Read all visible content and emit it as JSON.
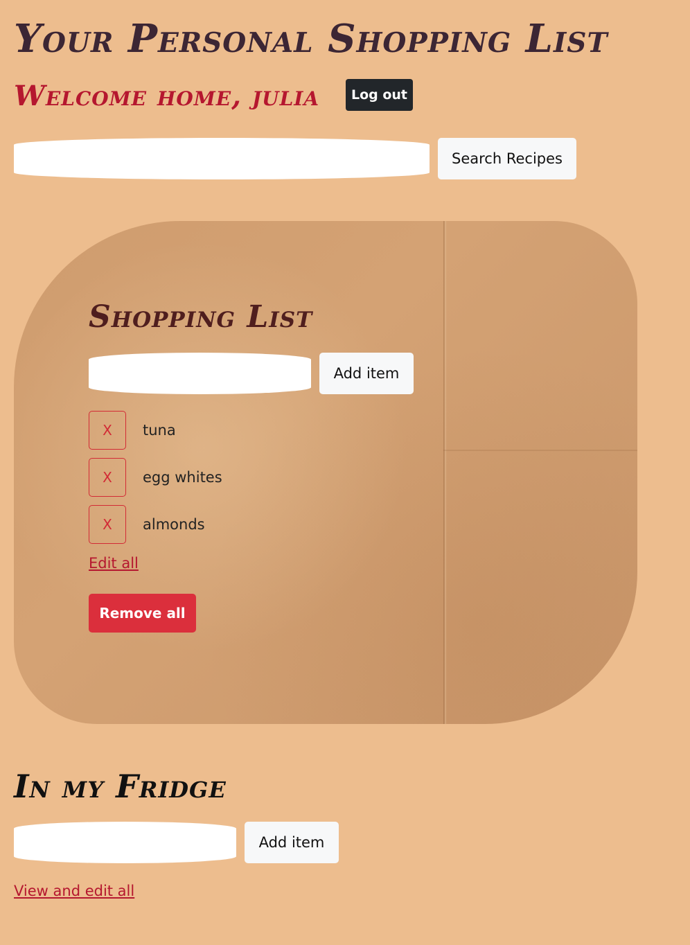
{
  "header": {
    "title": "Your Personal Shopping List",
    "welcome": "Welcome home, julia",
    "logout_label": "Log out"
  },
  "search": {
    "value": "",
    "button_label": "Search Recipes"
  },
  "shopping_list": {
    "title": "Shopping List",
    "input_value": "",
    "add_label": "Add item",
    "remove_item_label": "X",
    "items": [
      {
        "label": "tuna"
      },
      {
        "label": "egg whites"
      },
      {
        "label": "almonds"
      }
    ],
    "edit_all_label": "Edit all",
    "remove_all_label": "Remove all"
  },
  "fridge": {
    "title": "In my Fridge",
    "input_value": "",
    "add_label": "Add item",
    "view_edit_label": "View and edit all"
  },
  "colors": {
    "background": "#edbd8e",
    "title": "#3c2634",
    "accent": "#b5172f",
    "danger": "#db2f3c",
    "dark_button": "#22262a"
  }
}
